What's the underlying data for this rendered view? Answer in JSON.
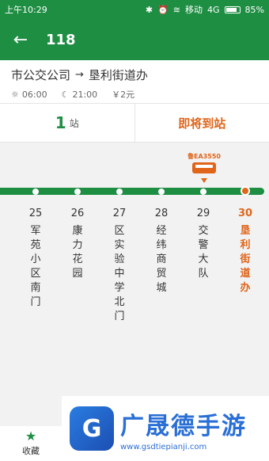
{
  "status": {
    "time": "上午10:29",
    "carrier": "移动",
    "network": "4G",
    "battery": "85%",
    "battery_level": 0.85
  },
  "appbar": {
    "back_icon": "arrow-left-icon",
    "title": "118"
  },
  "route": {
    "from": "市公交公司",
    "to": "垦利街道办",
    "first_bus": "06:00",
    "last_bus": "21:00",
    "fare": "￥2元"
  },
  "summary": {
    "stops_away": "1",
    "stops_unit": "站",
    "arriving_text": "即将到站"
  },
  "bus": {
    "plate": "鲁EA3550"
  },
  "stops": [
    {
      "num": "25",
      "name": "军苑小区南门"
    },
    {
      "num": "26",
      "name": "康力花园"
    },
    {
      "num": "27",
      "name": "区实验中学北门"
    },
    {
      "num": "28",
      "name": "经纬商贸城"
    },
    {
      "num": "29",
      "name": "交警大队"
    },
    {
      "num": "30",
      "name": "垦利街道办",
      "current": true
    }
  ],
  "favorite": {
    "label": "收藏"
  },
  "watermark": {
    "title": "广晟德手游",
    "url": "www.gsdtiepianji.com"
  }
}
